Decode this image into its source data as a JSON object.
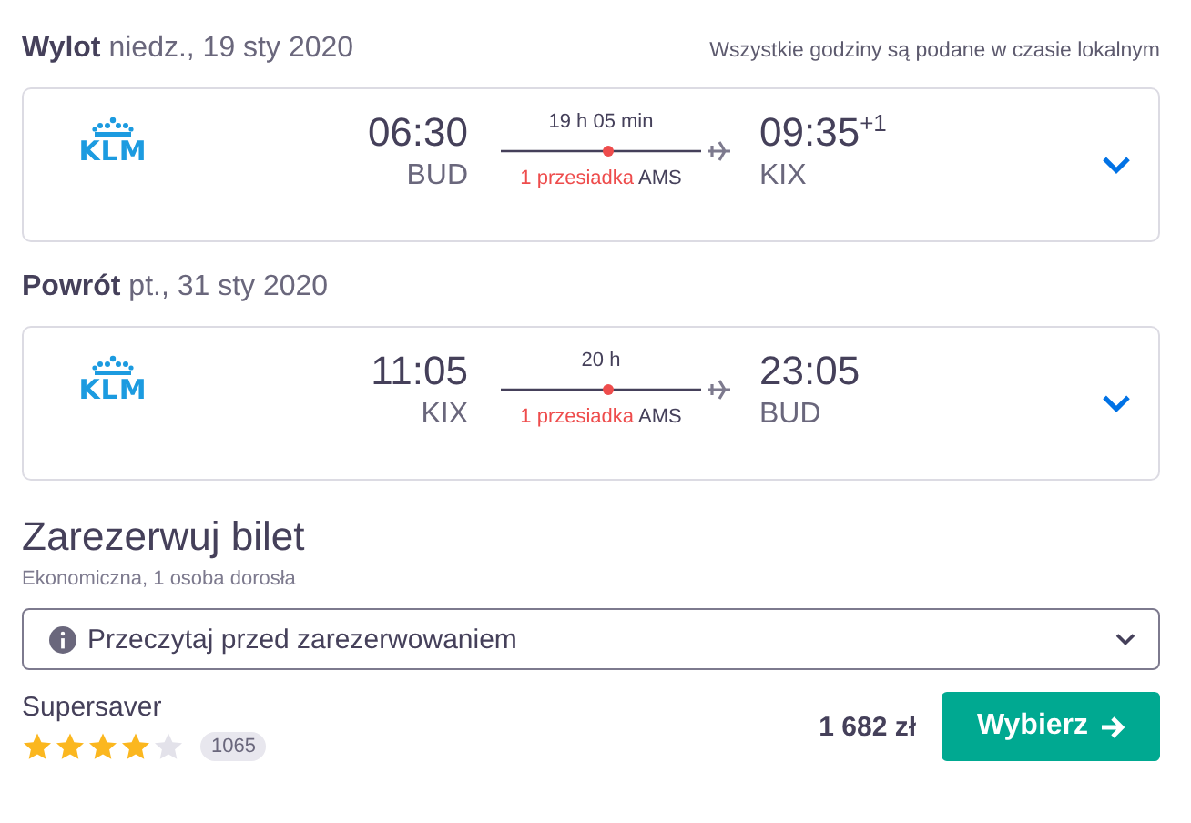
{
  "legs": [
    {
      "label": "Wylot",
      "date": "niedz., 19 sty 2020",
      "note": "Wszystkie godziny są podane w czasie lokalnym",
      "airline_logo": "KLM",
      "departure_time": "06:30",
      "departure_airport": "BUD",
      "duration": "19 h 05 min",
      "stops": "1 przesiadka",
      "stop_airport": "AMS",
      "arrival_time": "09:35",
      "day_offset": "+1",
      "arrival_airport": "KIX",
      "expanded": false
    },
    {
      "label": "Powrót",
      "date": "pt., 31 sty 2020",
      "airline_logo": "KLM",
      "departure_time": "11:05",
      "departure_airport": "KIX",
      "duration": "20 h",
      "stops": "1 przesiadka",
      "stop_airport": "AMS",
      "arrival_time": "23:05",
      "arrival_airport": "BUD",
      "expanded": false
    }
  ],
  "booking": {
    "title": "Zarezerwuj bilet",
    "subtitle": "Ekonomiczna, 1 osoba dorosła",
    "info_dropdown": {
      "label": "Przeczytaj przed zarezerwowaniem",
      "expanded": false
    },
    "offer": {
      "provider": "Supersaver",
      "stars": 4,
      "review_count": "1065",
      "price": "1 682 zł",
      "button": "Wybierz"
    }
  }
}
